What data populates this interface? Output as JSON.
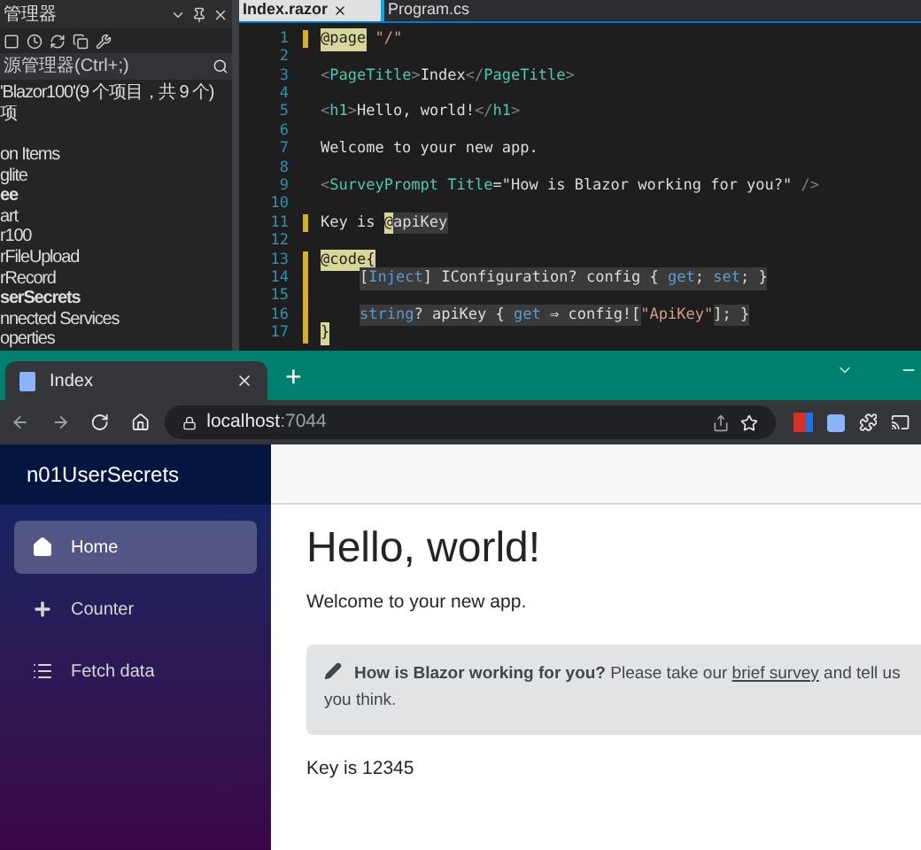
{
  "explorer": {
    "title": "管理器",
    "search": {
      "placeholder": "源管理器(Ctrl+;)"
    },
    "items": [
      {
        "label": "'Blazor100'(9 个项目，共 9 个)",
        "bold": false
      },
      {
        "label": "项",
        "bold": false
      },
      {
        "label": "on Items",
        "bold": false
      },
      {
        "label": "glite",
        "bold": false
      },
      {
        "label": "ee",
        "bold": true
      },
      {
        "label": "art",
        "bold": false
      },
      {
        "label": "r100",
        "bold": false
      },
      {
        "label": "rFileUpload",
        "bold": false
      },
      {
        "label": "rRecord",
        "bold": false
      },
      {
        "label": "serSecrets",
        "bold": true
      },
      {
        "label": "nnected Services",
        "bold": false
      },
      {
        "label": "operties",
        "bold": false
      }
    ]
  },
  "editor": {
    "tabs": [
      {
        "label": "Index.razor",
        "selected": true
      },
      {
        "label": "Program.cs",
        "selected": false
      }
    ],
    "lines": [
      {
        "number": "1",
        "changed": true,
        "tokens": [
          {
            "kind": "directive",
            "text": "@page"
          },
          {
            "kind": "string",
            "text": " \"/\""
          }
        ]
      },
      {
        "number": "2",
        "changed": false
      },
      {
        "number": "3",
        "changed": false,
        "tokens": [
          {
            "kind": "punct",
            "text": "<"
          },
          {
            "kind": "tag",
            "text": "PageTitle"
          },
          {
            "kind": "punct",
            "text": ">"
          },
          {
            "kind": "plain",
            "text": "Index"
          },
          {
            "kind": "punct",
            "text": "</"
          },
          {
            "kind": "tag",
            "text": "PageTitle"
          },
          {
            "kind": "punct",
            "text": ">"
          }
        ]
      },
      {
        "number": "4",
        "changed": false
      },
      {
        "number": "5",
        "changed": false,
        "tokens": [
          {
            "kind": "punct",
            "text": "<"
          },
          {
            "kind": "tag",
            "text": "h1"
          },
          {
            "kind": "punct",
            "text": ">"
          },
          {
            "kind": "plain",
            "text": "Hello, world!"
          },
          {
            "kind": "punct",
            "text": "</"
          },
          {
            "kind": "tag",
            "text": "h1"
          },
          {
            "kind": "punct",
            "text": ">"
          }
        ]
      },
      {
        "number": "6",
        "changed": false
      },
      {
        "number": "7",
        "changed": false,
        "tokens": [
          {
            "kind": "plain",
            "text": "Welcome to your new app."
          }
        ]
      },
      {
        "number": "8",
        "changed": false
      },
      {
        "number": "9",
        "changed": false,
        "tokens": [
          {
            "kind": "punct",
            "text": "<"
          },
          {
            "kind": "tag",
            "text": "SurveyPrompt"
          },
          {
            "kind": "tag",
            "text": " Title"
          },
          {
            "kind": "plain",
            "text": "=\"How is Blazor working for you?\" "
          },
          {
            "kind": "punct",
            "text": "/>"
          }
        ]
      },
      {
        "number": "10",
        "changed": false
      },
      {
        "number": "11",
        "changed": true,
        "tokens": [
          {
            "kind": "plain",
            "text": "Key is "
          },
          {
            "kind": "directive",
            "text": "@"
          },
          {
            "kind": "code",
            "text": "apiKey"
          }
        ]
      },
      {
        "number": "12",
        "changed": false
      },
      {
        "number": "13",
        "changed": true,
        "tokens": [
          {
            "kind": "directive",
            "text": "@code{"
          }
        ]
      },
      {
        "number": "14",
        "changed": true,
        "indent": true,
        "tokens": [
          {
            "kind": "code",
            "text": "["
          },
          {
            "kind": "keyword",
            "text": "Inject"
          },
          {
            "kind": "code",
            "text": "] IConfiguration? config { "
          },
          {
            "kind": "keyword",
            "text": "get"
          },
          {
            "kind": "code",
            "text": "; "
          },
          {
            "kind": "keyword",
            "text": "set"
          },
          {
            "kind": "code",
            "text": "; }"
          }
        ]
      },
      {
        "number": "15",
        "changed": true
      },
      {
        "number": "16",
        "changed": true,
        "indent": true,
        "tokens": [
          {
            "kind": "keyword",
            "text": "string"
          },
          {
            "kind": "code",
            "text": "? apiKey { "
          },
          {
            "kind": "keyword",
            "text": "get"
          },
          {
            "kind": "code",
            "text": " ⇒ config!["
          },
          {
            "kind": "string",
            "text": "\"ApiKey\""
          },
          {
            "kind": "code",
            "text": "]; }"
          }
        ]
      },
      {
        "number": "17",
        "changed": true,
        "tokens": [
          {
            "kind": "directive",
            "text": "}"
          }
        ]
      }
    ]
  },
  "browser": {
    "tab": {
      "title": "Index"
    },
    "new_tab": "+",
    "address": {
      "host": "localhost",
      "port": ":7044"
    }
  },
  "app": {
    "brand": "n01UserSecrets",
    "nav": [
      {
        "label": "Home",
        "selected": true
      },
      {
        "label": "Counter",
        "selected": false
      },
      {
        "label": "Fetch data",
        "selected": false
      }
    ],
    "heading": "Hello, world!",
    "welcome": "Welcome to your new app.",
    "survey": {
      "title": "How is Blazor working for you?",
      "before": "Please take our",
      "link": "brief survey",
      "after": "and tell us",
      "line2": "you think."
    },
    "key_text": "Key is 12345"
  }
}
